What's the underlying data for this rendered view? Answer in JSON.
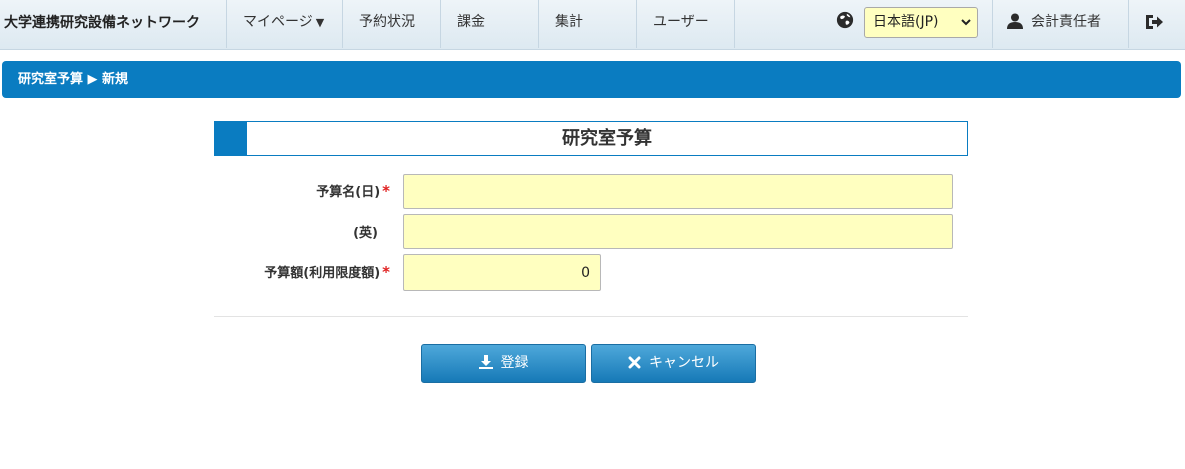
{
  "navbar": {
    "brand": "大学連携研究設備ネットワーク",
    "items": [
      {
        "label": "マイページ",
        "has_caret": true
      },
      {
        "label": "予約状況"
      },
      {
        "label": "課金"
      },
      {
        "label": "集計"
      },
      {
        "label": "ユーザー"
      }
    ],
    "language": {
      "selected": "日本語(JP)",
      "icon": "globe-icon"
    },
    "user": {
      "label": "会計責任者",
      "icon": "user-icon"
    },
    "logout": {
      "icon": "logout-icon"
    }
  },
  "breadcrumb": {
    "text": "研究室予算 ▶ 新規"
  },
  "section": {
    "title": "研究室予算"
  },
  "form": {
    "budget_name_ja": {
      "label": "予算名(日)",
      "required": true,
      "value": ""
    },
    "budget_name_en": {
      "label": "(英)",
      "required": false,
      "value": ""
    },
    "budget_amount": {
      "label": "予算額(利用限度額)",
      "required": true,
      "value": "0"
    }
  },
  "actions": {
    "register": {
      "label": "登録",
      "icon": "download-icon"
    },
    "cancel": {
      "label": "キャンセル",
      "icon": "close-icon"
    }
  },
  "colors": {
    "primary": "#0a7cc1",
    "input_bg": "#ffffc0",
    "required": "#e02020"
  }
}
